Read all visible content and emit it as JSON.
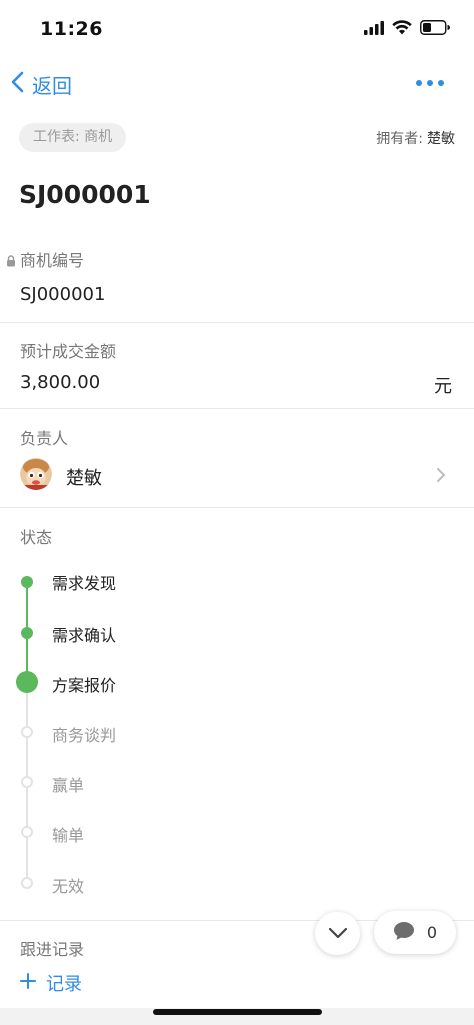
{
  "status_bar": {
    "time": "11:26"
  },
  "nav": {
    "back_label": "返回"
  },
  "header": {
    "sheet_tag": "工作表: 商机",
    "owner_label": "拥有者:",
    "owner_name": "楚敏",
    "record_title": "SJ000001"
  },
  "fields": {
    "opportunity_id": {
      "label": "商机编号",
      "value": "SJ000001"
    },
    "expected_amount": {
      "label": "预计成交金额",
      "value": "3,800.00",
      "unit": "元"
    },
    "assignee": {
      "label": "负责人",
      "value": "楚敏"
    },
    "status": {
      "label": "状态",
      "current": "方案报价",
      "steps": [
        {
          "label": "需求发现",
          "state": "done"
        },
        {
          "label": "需求确认",
          "state": "done"
        },
        {
          "label": "方案报价",
          "state": "current"
        },
        {
          "label": "商务谈判",
          "state": "pending"
        },
        {
          "label": "赢单",
          "state": "pending"
        },
        {
          "label": "输单",
          "state": "pending"
        },
        {
          "label": "无效",
          "state": "pending"
        }
      ]
    }
  },
  "followup": {
    "label": "跟进记录",
    "add_label": "记录"
  },
  "floating": {
    "comment_count": "0"
  },
  "colors": {
    "accent": "#2f8de4",
    "done": "#5cb85c",
    "pending": "#d8d8d8"
  }
}
